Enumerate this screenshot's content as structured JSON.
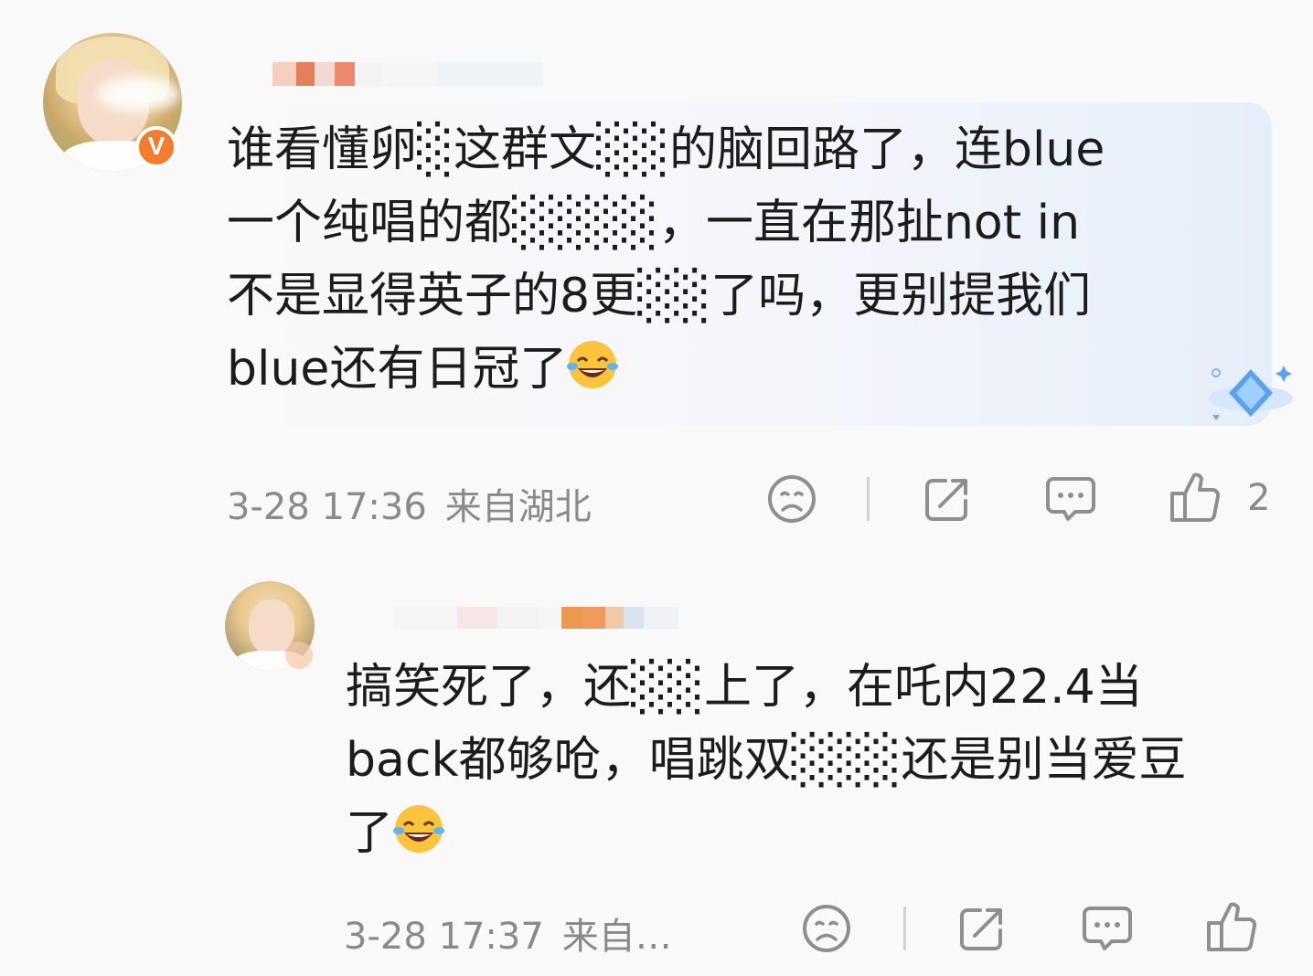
{
  "main_comment": {
    "text_lines": [
      "谁看懂卵░这群文░░的脑回路了，连blue",
      "一个纯唱的都░░░░，一直在那扯not in",
      "不是显得英子的8更░░了吗，更别提我们",
      "blue还有日冠了"
    ],
    "emoji": "laughing-crying-emoji",
    "time": "3-28 17:36",
    "location": "来自湖北",
    "like_count": "2"
  },
  "reply": {
    "text_lines": [
      "搞笑死了，还░░上了，在吒内22.4当",
      "back都够呛，唱跳双░░░还是别当爱豆",
      "了"
    ],
    "emoji": "laughing-crying-emoji",
    "time": "3-28 17:37",
    "location": "来自…"
  },
  "colors": {
    "badge": "#f47c2c",
    "meta_text": "#8a8a8a",
    "icon_stroke": "#8f8f8f",
    "bubble_accent": "#e6eef9"
  },
  "icons": [
    "dislike-face-icon",
    "share-icon",
    "comment-icon",
    "like-thumb-icon",
    "diamond-icon"
  ]
}
